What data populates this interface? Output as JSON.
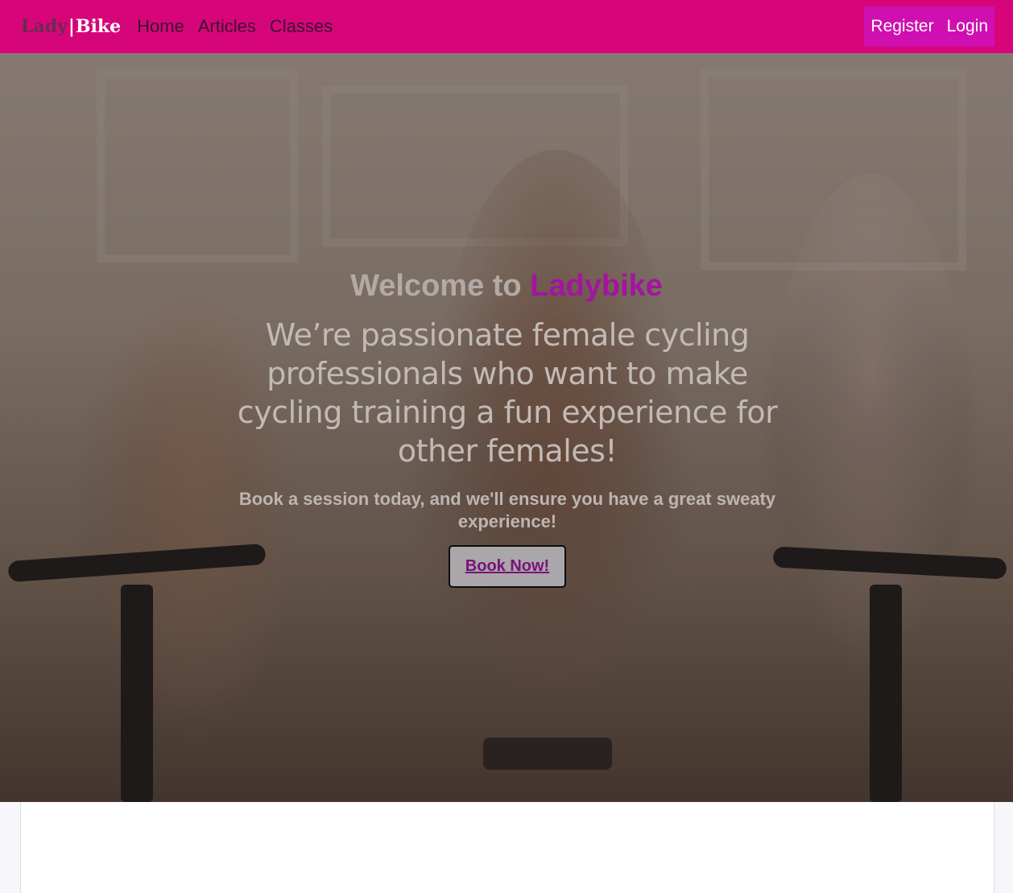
{
  "navbar": {
    "brand_lady": "Lady",
    "brand_sep": "|",
    "brand_bike": "Bike",
    "links": [
      "Home",
      "Articles",
      "Classes"
    ],
    "register": "Register",
    "login": "Login",
    "bg_color": "#d6067a",
    "auth_bg_color": "#cf0fb0"
  },
  "hero": {
    "title_prefix": "Welcome to ",
    "title_accent": "Ladybike",
    "subtitle": "We’re passionate female cycling professionals who want to make cycling training a fun experience for other females!",
    "book_text": "Book a session today, and we'll ensure you have a great sweaty experience!",
    "button_label": "Book Now!",
    "accent_color": "#a314a0"
  }
}
